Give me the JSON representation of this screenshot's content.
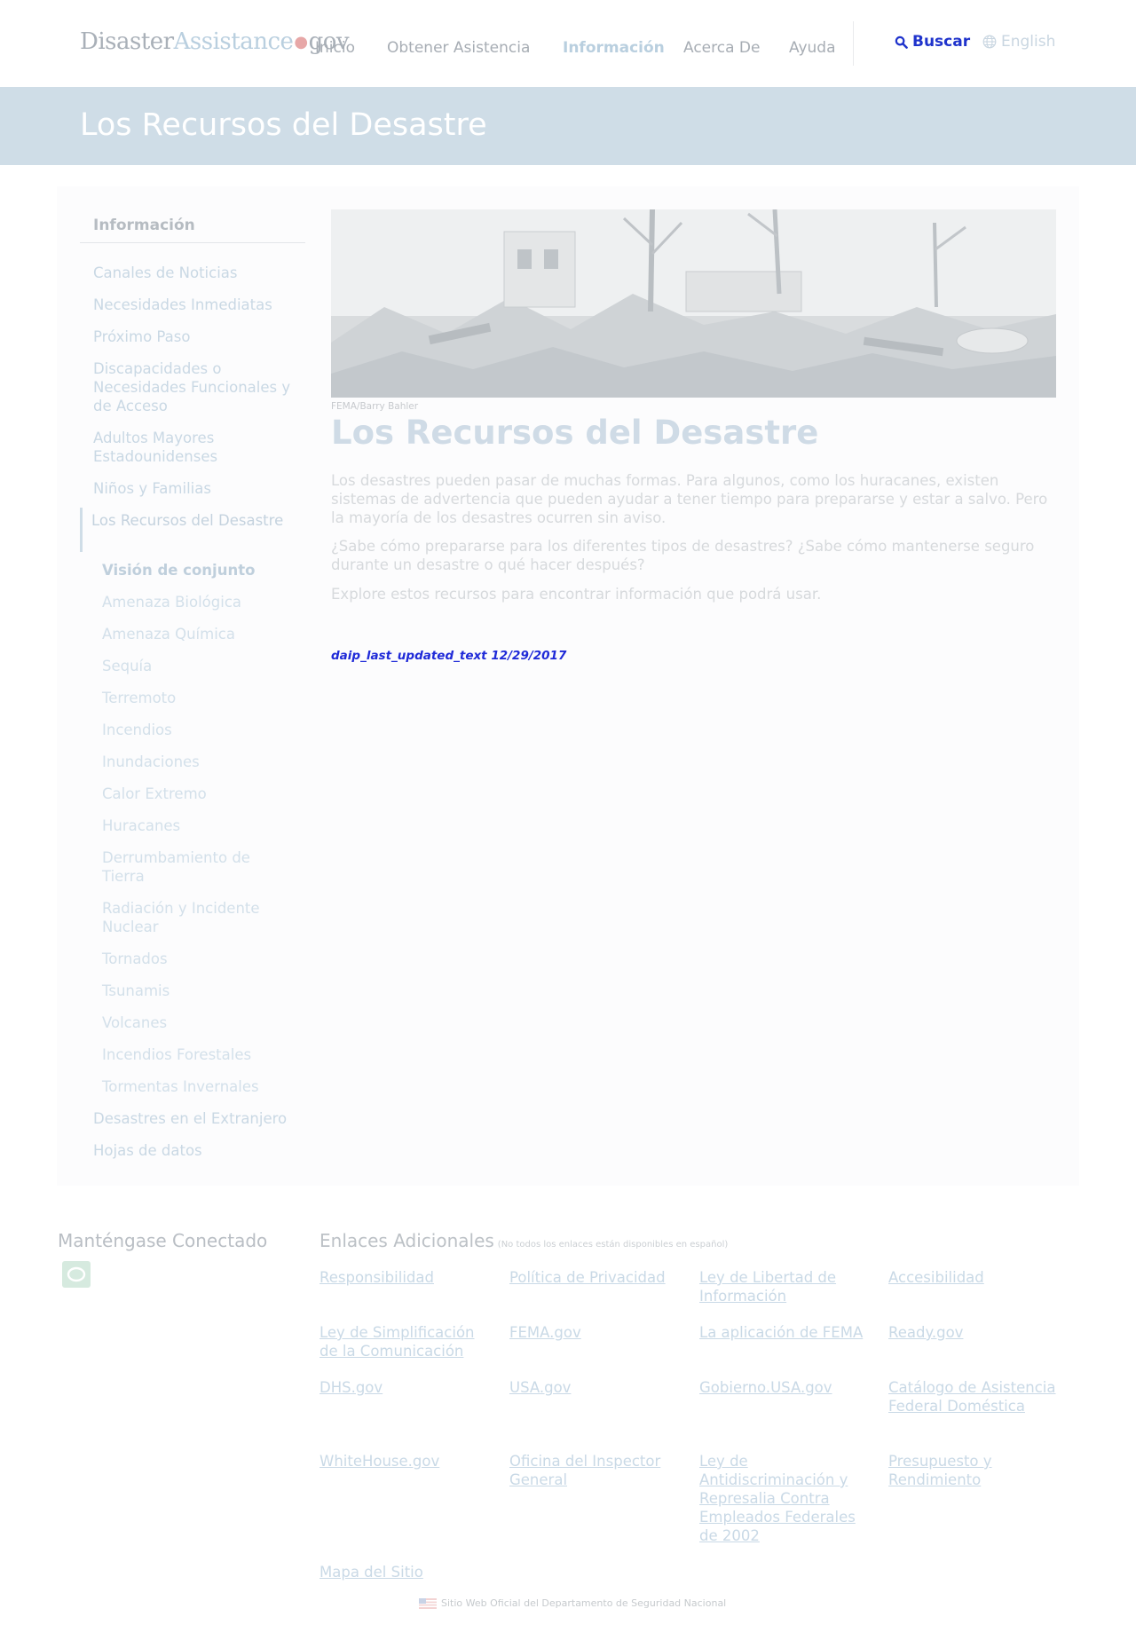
{
  "header": {
    "logo": {
      "part1": "Disaster",
      "part2": "Assistance",
      "dot": "●",
      "part3": "gov"
    },
    "nav": [
      "Inicio",
      "Obtener Asistencia",
      "Información",
      "Acerca De",
      "Ayuda"
    ],
    "nav_active_index": 2,
    "search_label": "Buscar",
    "search_icon": "search-icon",
    "language_label": "English",
    "language_icon": "globe-icon",
    "colors": {
      "search": "#1f33cc",
      "banner": "#cfdde7"
    }
  },
  "banner": {
    "title": "Los Recursos del Desastre"
  },
  "sidebar": {
    "title": "Información",
    "items": [
      "Canales de Noticias",
      "Necesidades Inmediatas",
      "Próximo Paso",
      "Discapacidades o Necesidades Funcionales y de Acceso",
      "Adultos Mayores Estadounidenses",
      "Niños y Familias",
      "Los Recursos del Desastre"
    ],
    "sub_items": [
      "Visión de conjunto",
      "Amenaza Biológica",
      "Amenaza Química",
      "Sequía",
      "Terremoto",
      "Incendios",
      "Inundaciones",
      "Calor Extremo",
      "Huracanes",
      "Derrumbamiento de Tierra",
      "Radiación y Incidente Nuclear",
      "Tornados",
      "Tsunamis",
      "Volcanes",
      "Incendios Forestales",
      "Tormentas Invernales"
    ],
    "after_items": [
      "Desastres en el Extranjero",
      "Hojas de datos"
    ]
  },
  "main": {
    "image_caption": "FEMA/Barry Bahler",
    "title": "Los Recursos del Desastre",
    "paragraphs": [
      "Los desastres pueden pasar de muchas formas. Para algunos, como los huracanes, existen sistemas de advertencia que pueden ayudar a tener tiempo para prepararse y estar a salvo. Pero la mayoría de los desastres ocurren sin aviso.",
      "¿Sabe cómo prepararse para los diferentes tipos de desastres? ¿Sabe cómo mantenerse seguro durante un desastre o qué hacer después?",
      "Explore estos recursos para encontrar información que podrá usar."
    ],
    "last_updated": "daip_last_updated_text 12/29/2017"
  },
  "footer": {
    "stay_connected": "Manténgase Conectado",
    "social_icon": "social-media-icon",
    "links_title": "Enlaces Adicionales",
    "links_note": "(No todos los enlaces están disponibles en español)",
    "links": [
      "Responsibilidad",
      "Política de Privacidad",
      "Ley de Libertad de Información",
      "Accesibilidad",
      "Ley de Simplificación de la Comunicación",
      "FEMA.gov",
      "La aplicación de FEMA",
      "Ready.gov",
      "DHS.gov",
      "USA.gov",
      "Gobierno.USA.gov",
      "Catálogo de Asistencia Federal Doméstica",
      "WhiteHouse.gov",
      "Oficina del Inspector General",
      "Ley de Antidiscriminación y Represalia Contra Empleados Federales de 2002",
      "Presupuesto y Rendimiento",
      "Mapa del Sitio"
    ],
    "official_text": "Sitio Web Oficial del Departamento de Seguridad Nacional",
    "official_icon": "us-flag-icon"
  }
}
